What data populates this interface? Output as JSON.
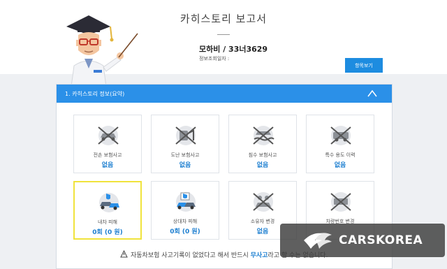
{
  "page": {
    "title": "카히스토리 보고서",
    "car_info": "모하비 / 33너3629",
    "query_date_label": "정보조회일자 :",
    "items_button": "항목보기"
  },
  "panel": {
    "header": "1. 카히스토리 정보(요약)",
    "toggle_icon": "chevron-up-icon"
  },
  "cards": [
    {
      "label": "전손 보험사고",
      "value": "없음",
      "icon": "total-loss-icon",
      "highlighted": false
    },
    {
      "label": "도난 보험사고",
      "value": "없음",
      "icon": "theft-icon",
      "highlighted": false
    },
    {
      "label": "침수 보험사고",
      "value": "없음",
      "icon": "flood-icon",
      "highlighted": false
    },
    {
      "label": "특수 용도 이력",
      "value": "없음",
      "icon": "special-use-icon",
      "highlighted": false
    },
    {
      "label": "내차 피해",
      "value": "0회 (0 원)",
      "icon": "my-car-damage-icon",
      "highlighted": true
    },
    {
      "label": "상대차 피해",
      "value": "0회 (0 원)",
      "icon": "other-car-damage-icon",
      "highlighted": false
    },
    {
      "label": "소유자 변경",
      "value": "없음",
      "icon": "owner-change-icon",
      "highlighted": false
    },
    {
      "label": "차량번호 변경",
      "value": "",
      "icon": "plate-change-icon",
      "highlighted": false
    }
  ],
  "notice": {
    "pre": "자동차보험 사고기록이 없었다고 해서 반드시 ",
    "highlight": "무사고",
    "post": "라고 할 수는 없습니다."
  },
  "watermark": {
    "text": "CARSKOREA"
  },
  "colors": {
    "accent": "#2b90e8",
    "value": "#1d7fd0",
    "highlight_border": "#f0e33c"
  }
}
